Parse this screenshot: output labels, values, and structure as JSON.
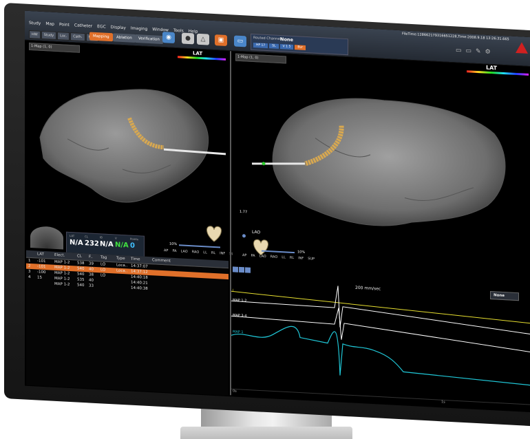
{
  "menu": [
    "Study",
    "Map",
    "Point",
    "Catheter",
    "EGC",
    "Display",
    "Imaging",
    "Window",
    "Tools",
    "Help"
  ],
  "filetime": "FileTime:128662179316651228,Time:2008.9.18 13:26:31.665",
  "mode_tabs": [
    "HW",
    "Study",
    "Loc.",
    "Cath.",
    "Map"
  ],
  "mode_buttons": {
    "mapping": "Mapping",
    "ablation": "Ablation",
    "verification": "Verification"
  },
  "channel": {
    "label": "Routed Channel",
    "value": "None",
    "buttons": [
      "HP 17",
      "SL",
      "V 1 5",
      "Bur"
    ]
  },
  "viewport_left": {
    "map_label": "1-Map (1, 0)",
    "lat_label": "LAT"
  },
  "viewport_right": {
    "map_label": "1-Map (1, 0)",
    "lat_label": "LAT",
    "view_label": "LAO"
  },
  "zoom": {
    "left_pct": "10%",
    "right_pct": "10%",
    "scale_top": "1.77"
  },
  "orientation_left": [
    "AP",
    "PA",
    "LAO",
    "RAO",
    "LL",
    "RL",
    "INF",
    "SUP"
  ],
  "orientation_right": [
    "AP",
    "PA",
    "LAO",
    "RAO",
    "LL",
    "RL",
    "INF",
    "SUP"
  ],
  "info_panel": {
    "labels": [
      "LAT",
      "CL",
      "IB",
      "V",
      "Points"
    ],
    "values": [
      "N/A",
      "232",
      "N/A",
      "N/A",
      "0"
    ],
    "colors": [
      "#ffffff",
      "#ffffff",
      "#ffffff",
      "#40e040",
      "#40c0ff"
    ]
  },
  "table": {
    "headers": [
      "",
      "LAT",
      "Elect.",
      "CL",
      "F..",
      "Tag",
      "Type",
      "Time",
      "Comment"
    ],
    "rows": [
      [
        "1",
        "-101",
        "MAP 1-2",
        "538",
        "39",
        "LO",
        "Loca..",
        "14:37:07",
        ""
      ],
      [
        "2",
        "-101",
        "MAP 1-2",
        "540",
        "40",
        "LO",
        "Loca..",
        "14:37:12",
        ""
      ],
      [
        "3",
        "-100",
        "MAP 1-2",
        "540",
        "38",
        "LO",
        "",
        "14:40:18",
        ""
      ],
      [
        "4",
        "15",
        "MAP 1-2",
        "535",
        "40",
        "",
        "",
        "14:40:21",
        ""
      ],
      [
        "",
        "",
        "MAP 1-2",
        "540",
        "33",
        "",
        "",
        "14:40:38",
        ""
      ]
    ],
    "selected_row": 1
  },
  "waveform": {
    "speed": "200 mm/sec",
    "dropdown": "None",
    "channels": [
      "I",
      "MAP 1-2",
      "MAP 3-4",
      "MAP 1"
    ],
    "channel_colors": [
      "#e8e030",
      "#ffffff",
      "#ffffff",
      "#20c8d8"
    ],
    "ticks": [
      "0s",
      "1s"
    ]
  },
  "colors": {
    "accent": "#e0702a",
    "blue": "#4a86c8",
    "mesh": "#777777",
    "catheter": "#d8a850"
  }
}
